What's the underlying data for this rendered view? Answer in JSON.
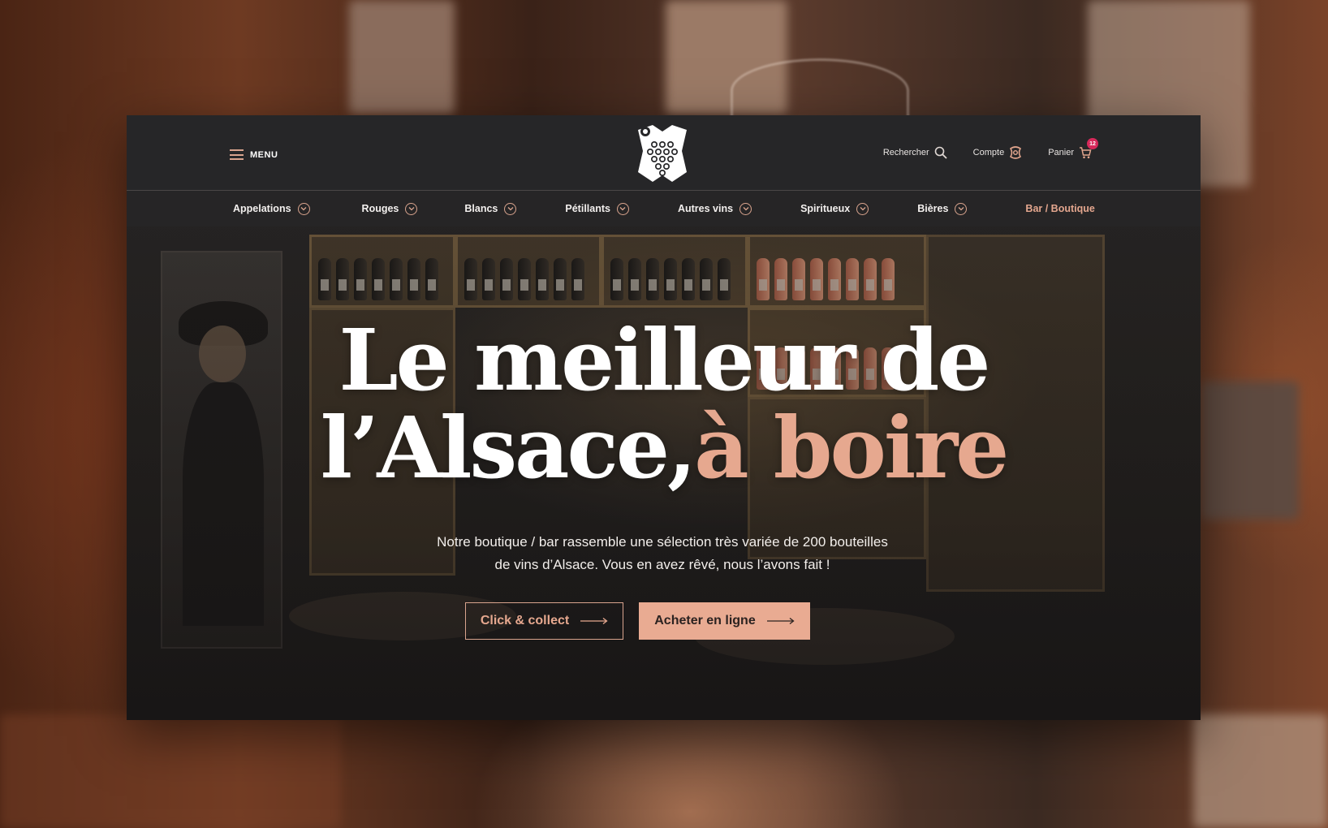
{
  "header": {
    "menu_label": "MENU",
    "search_label": "Rechercher",
    "account_label": "Compte",
    "cart_label": "Panier",
    "cart_count": "12"
  },
  "nav": {
    "items": [
      {
        "label": "Appelations"
      },
      {
        "label": "Rouges"
      },
      {
        "label": "Blancs"
      },
      {
        "label": "Pétillants"
      },
      {
        "label": "Autres vins"
      },
      {
        "label": "Spiritueux"
      },
      {
        "label": "Bières"
      }
    ],
    "highlight": "Bar / Boutique"
  },
  "hero": {
    "title_line1": "Le meilleur de",
    "title_line2_white": "l’Alsace,",
    "title_line2_accent": "à boire",
    "subtitle_line1": "Notre boutique / bar rassemble une sélection très variée de 200 bouteilles",
    "subtitle_line2": "de vins d’Alsace.  Vous en avez rêvé, nous l’avons fait !",
    "btn_click_collect": "Click & collect",
    "btn_buy_online": "Acheter en ligne"
  },
  "colors": {
    "accent": "#e6a88f",
    "header_bg": "#262628",
    "badge": "#d6285a"
  },
  "icons": [
    "menu-icon",
    "logo-grape-icon",
    "search-icon",
    "account-icon",
    "cart-icon",
    "chevron-down-icon",
    "arrow-right-icon"
  ]
}
